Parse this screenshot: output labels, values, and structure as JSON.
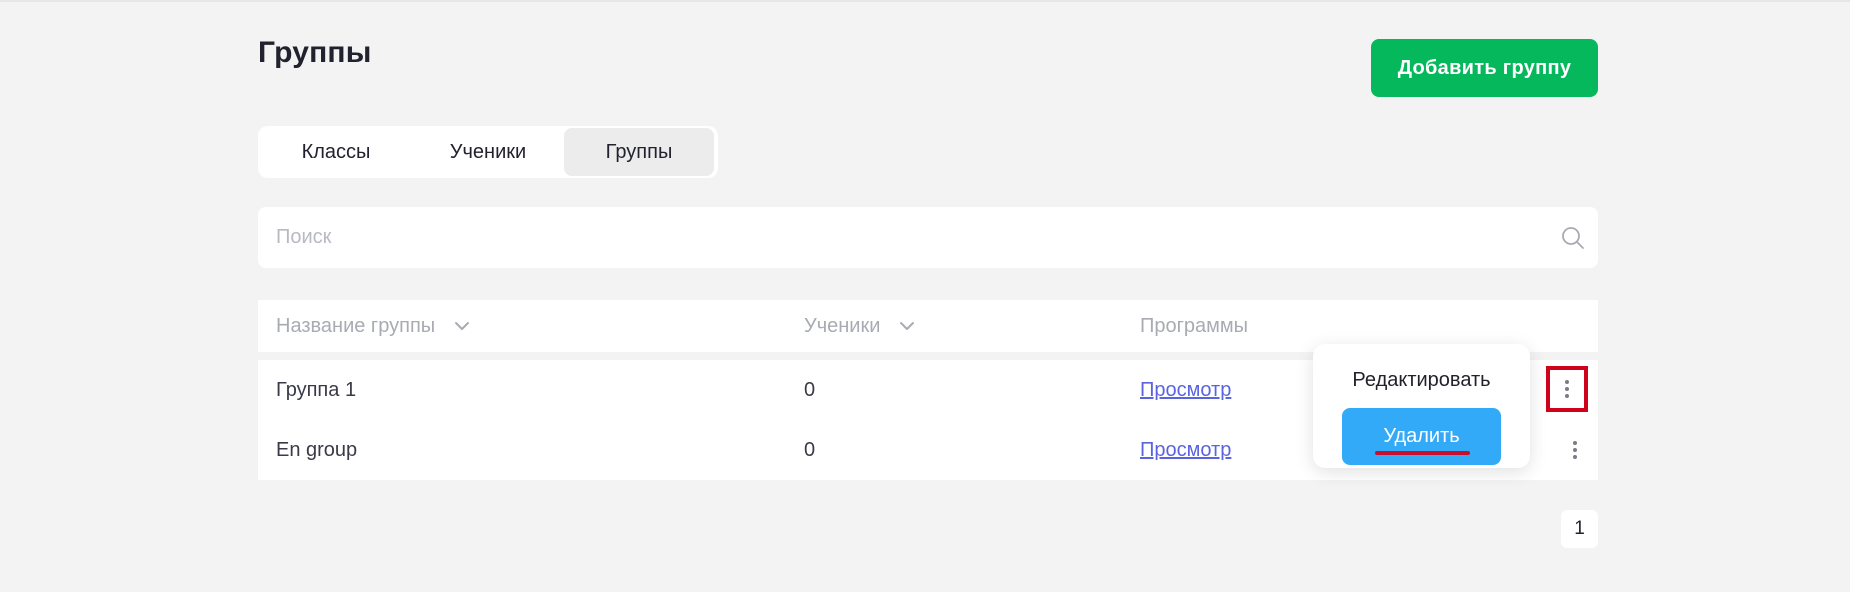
{
  "page": {
    "title": "Группы",
    "add_button_label": "Добавить группу"
  },
  "tabs": [
    {
      "label": "Классы"
    },
    {
      "label": "Ученики"
    },
    {
      "label": "Группы",
      "active": true
    }
  ],
  "search": {
    "placeholder": "Поиск",
    "value": ""
  },
  "table": {
    "columns": [
      {
        "label": "Название группы",
        "sortable": true
      },
      {
        "label": "Ученики",
        "sortable": true
      },
      {
        "label": "Программы",
        "sortable": false
      }
    ],
    "rows": [
      {
        "name": "Группа 1",
        "students": "0",
        "programs_link": "Просмотр"
      },
      {
        "name": "En group",
        "students": "0",
        "programs_link": "Просмотр"
      }
    ]
  },
  "context_menu": {
    "edit_label": "Редактировать",
    "delete_label": "Удалить"
  },
  "pagination": {
    "current_page": "1"
  },
  "colors": {
    "background": "#f3f3f3",
    "primary_green": "#05b85c",
    "delete_blue": "#33aaf7",
    "link": "#5b63e0",
    "annotation_red": "#d0021b"
  },
  "icons": {
    "search": "search-icon",
    "sort": "chevron-down-icon",
    "row_menu": "kebab-menu-icon"
  }
}
